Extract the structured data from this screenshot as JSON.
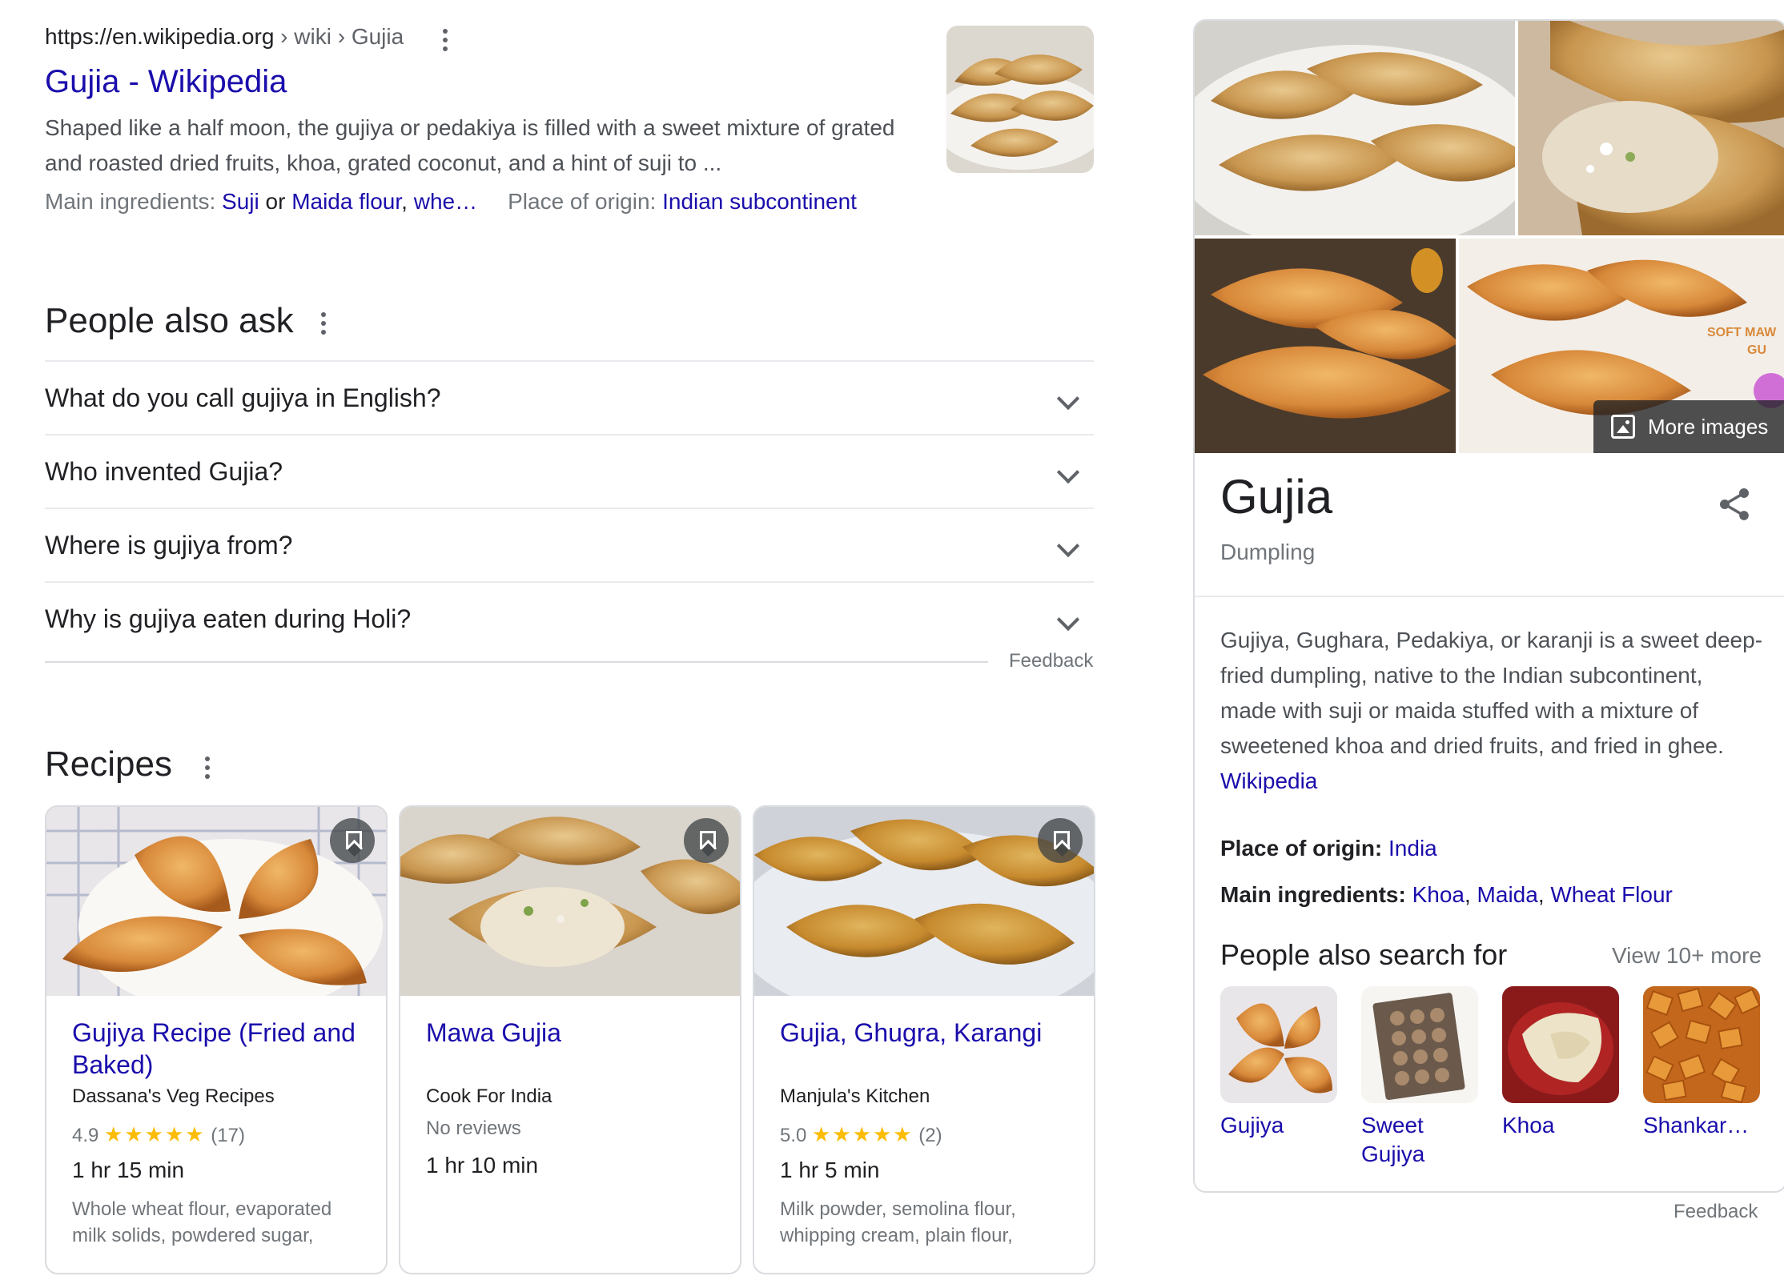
{
  "wiki": {
    "url_base": "https://en.wikipedia.org",
    "url_path": " › wiki › Gujia",
    "title": "Gujia - Wikipedia",
    "snippet": "Shaped like a half moon, the gujiya or pedakiya is filled with a sweet mixture of grated and roasted dried fruits, khoa, grated coconut, and a hint of suji to ...",
    "ingredients_label": "Main ingredients: ",
    "ingredient_1": "Suji",
    "ingredient_or": " or ",
    "ingredient_2": "Maida flour",
    "ingredient_sep": ", ",
    "ingredient_3": "whe…",
    "origin_label": "Place of origin: ",
    "origin_value": "Indian subcontinent"
  },
  "paa": {
    "heading": "People also ask",
    "questions": [
      "What do you call gujiya in English?",
      "Who invented Gujia?",
      "Where is gujiya from?",
      "Why is gujiya eaten during Holi?"
    ],
    "feedback": "Feedback"
  },
  "recipes": {
    "heading": "Recipes",
    "cards": [
      {
        "title": "Gujiya Recipe (Fried and Baked)",
        "source": "Dassana's Veg Recipes",
        "rating": "4.9",
        "stars": "★★★★★",
        "reviews": "(17)",
        "time": "1 hr 15 min",
        "ingredients": "Whole wheat flour, evaporated milk solids, powdered sugar,"
      },
      {
        "title": "Mawa Gujia",
        "source": "Cook For India",
        "no_reviews": "No reviews",
        "time": "1 hr 10 min",
        "ingredients": ""
      },
      {
        "title": "Gujia, Ghugra, Karangi",
        "source": "Manjula's Kitchen",
        "rating": "5.0",
        "stars": "★★★★★",
        "reviews": "(2)",
        "time": "1 hr 5 min",
        "ingredients": "Milk powder, semolina flour, whipping cream, plain flour,"
      }
    ]
  },
  "kp": {
    "more_images": "More images",
    "title": "Gujia",
    "subtitle": "Dumpling",
    "description": "Gujiya, Gughara, Pedakiya, or karanji is a sweet deep-fried dumpling, native to the Indian subcontinent, made with suji or maida stuffed with a mixture of sweetened khoa and dried fruits, and fried in ghee. ",
    "description_source": "Wikipedia",
    "origin_label": "Place of origin: ",
    "origin_value": "India",
    "ingredients_label": "Main ingredients: ",
    "ingredient_1": "Khoa",
    "ingredient_2": "Maida",
    "ingredient_3": "Wheat Flour",
    "ingredient_sep": ", ",
    "pasf_heading": "People also search for",
    "pasf_more": "View 10+ more",
    "pasf": [
      "Gujiya",
      "Sweet Gujiya",
      "Khoa",
      "Shankar…"
    ],
    "feedback": "Feedback"
  },
  "icons": {
    "menu": "more-vert-icon",
    "chevron": "chevron-down-icon",
    "bookmark": "bookmark-icon",
    "share": "share-icon",
    "image": "image-icon"
  },
  "colors": {
    "link": "#1a0dab",
    "text": "#202124",
    "muted": "#70757a",
    "star": "#fbbc04",
    "border": "#dadce0"
  }
}
